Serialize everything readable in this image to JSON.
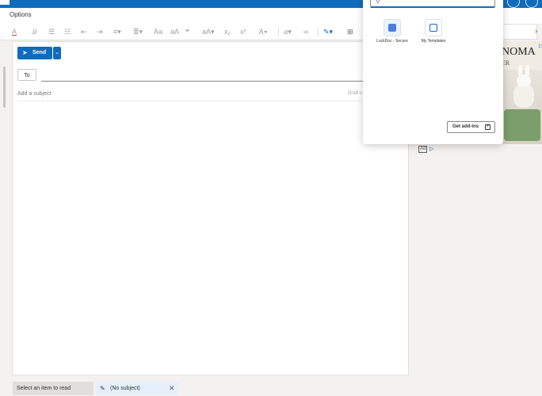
{
  "options_label": "Options",
  "compose": {
    "send_label": "Send",
    "to_label": "To",
    "subject_placeholder": "Add a subject",
    "draft_label": "Draft s"
  },
  "addins_panel": {
    "search_placeholder": "",
    "items": [
      {
        "label": "LockDoc - Secure",
        "icon": "lock-icon",
        "color": "#4a7fe0"
      },
      {
        "label": "My Templates",
        "icon": "template-icon",
        "color": "#0f6cbd"
      }
    ],
    "get_addins_label": "Get add-ins"
  },
  "ad": {
    "brand": "NOMA",
    "brand_line2": "ER",
    "ad_label": "Ad"
  },
  "taskbar": {
    "tab1": "Select an item to read",
    "tab2": "(No subject)"
  },
  "colors": {
    "accent": "#0f6cbd",
    "background": "#f3f2f1"
  }
}
